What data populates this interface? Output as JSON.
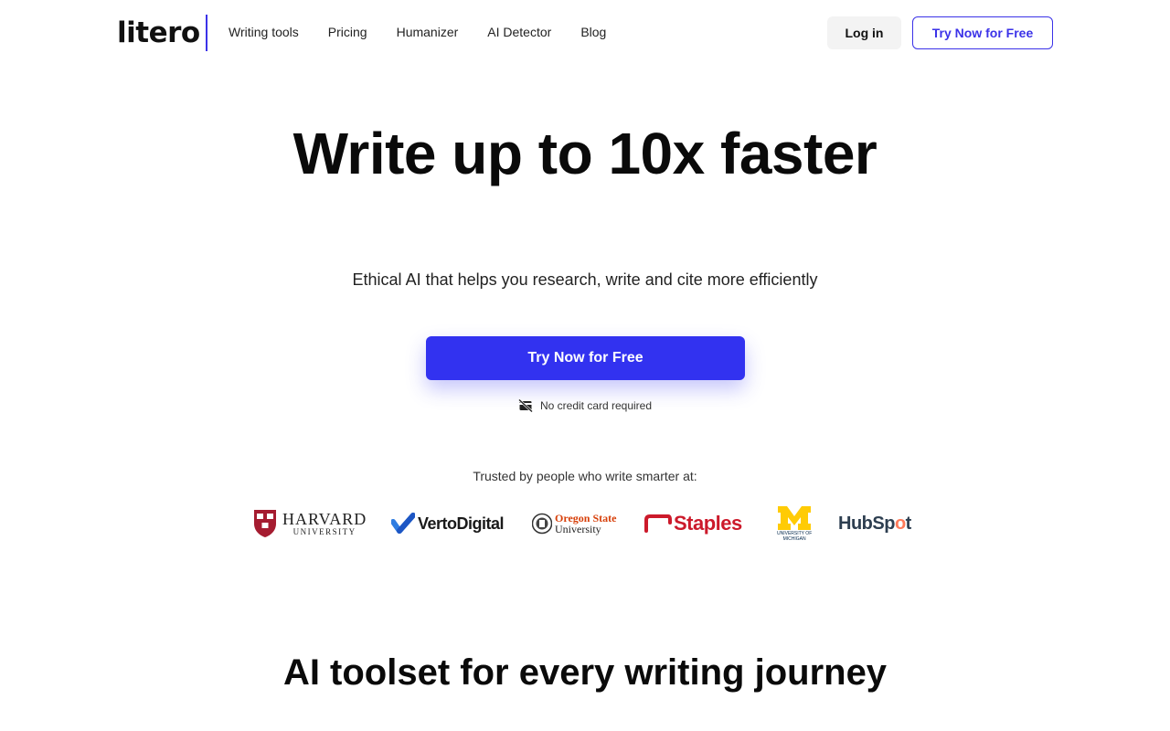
{
  "header": {
    "logo": "litero",
    "nav": [
      "Writing tools",
      "Pricing",
      "Humanizer",
      "AI Detector",
      "Blog"
    ],
    "login_label": "Log in",
    "try_label": "Try Now for Free"
  },
  "hero": {
    "title": "Write up to 10x faster",
    "subtitle": "Ethical AI that helps you research, write and cite more efficiently",
    "cta_label": "Try Now for Free",
    "no_credit_card": "No credit card required"
  },
  "trusted": {
    "heading": "Trusted by people who write smarter at:",
    "logos": {
      "harvard": {
        "name": "HARVARD",
        "sub": "UNIVERSITY"
      },
      "verto": {
        "name": "VertoDigital"
      },
      "oregon": {
        "top": "Oregon State",
        "bottom": "University"
      },
      "staples": {
        "name": "Staples"
      },
      "michigan": {
        "sub1": "UNIVERSITY OF",
        "sub2": "MICHIGAN"
      },
      "hubspot": {
        "part1": "HubSp",
        "part2": "o",
        "part3": "t"
      }
    }
  },
  "section2": {
    "title": "AI toolset for every writing journey"
  },
  "colors": {
    "accent": "#3232f0",
    "accent_border": "#3b32e8",
    "text": "#111111",
    "login_bg": "#f3f3f3"
  },
  "icons": {
    "no_card": "credit-card-off-icon"
  }
}
